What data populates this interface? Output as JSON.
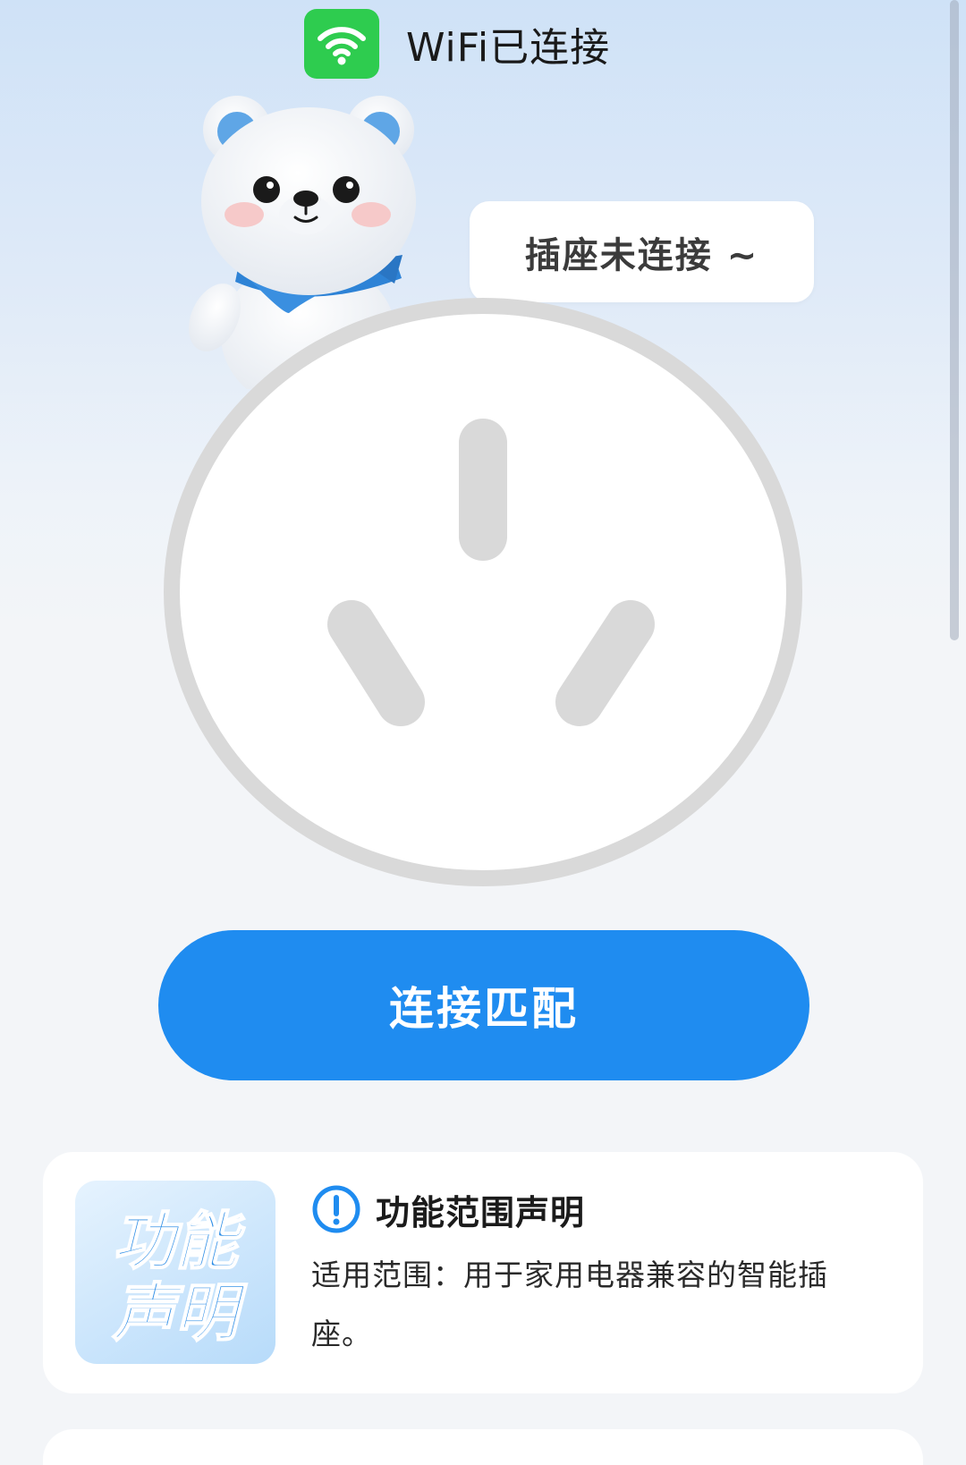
{
  "status": {
    "wifi_label": "WiFi已连接"
  },
  "mascot": {
    "speech": "插座未连接 ~"
  },
  "actions": {
    "connect_label": "连接匹配"
  },
  "declaration": {
    "logo_text": "功能声明",
    "title": "功能范围声明",
    "description": "适用范围：用于家用电器兼容的智能插座。"
  },
  "icons": {
    "wifi": "wifi-icon",
    "info": "info-icon",
    "socket": "socket-outlet-icon",
    "mascot": "polar-bear-mascot"
  },
  "colors": {
    "accent_blue": "#1f8cf0",
    "wifi_green": "#2ecc4f",
    "socket_gray": "#d9d9d9"
  }
}
